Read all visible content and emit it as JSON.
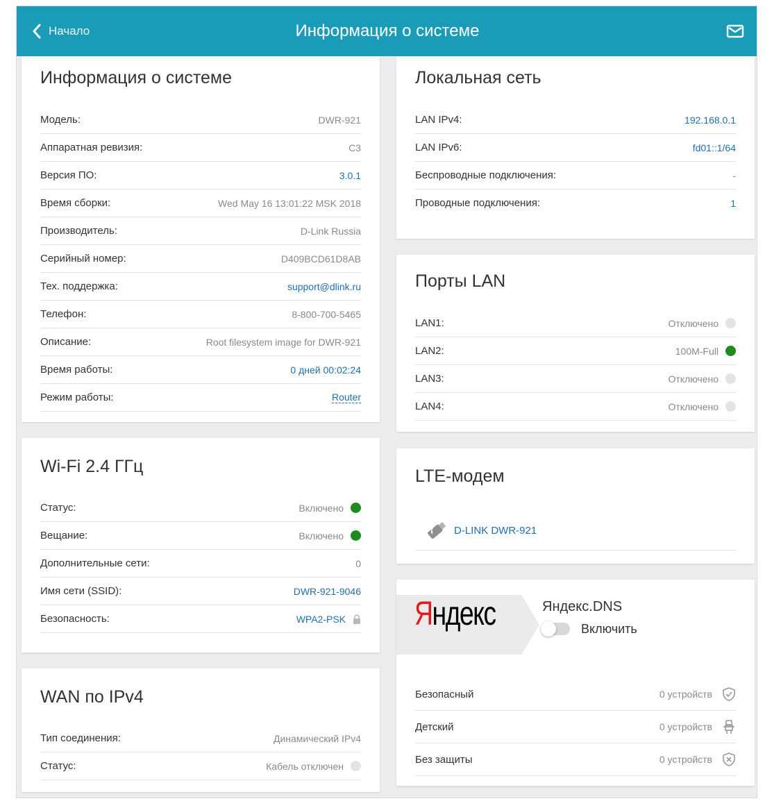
{
  "header": {
    "back_label": "Начало",
    "title": "Информация о системе"
  },
  "system": {
    "title": "Информация о системе",
    "rows": [
      {
        "label": "Модель:",
        "value": "DWR-921"
      },
      {
        "label": "Аппаратная ревизия:",
        "value": "C3"
      },
      {
        "label": "Версия ПО:",
        "value": "3.0.1"
      },
      {
        "label": "Время сборки:",
        "value": "Wed May 16 13:01:22 MSK 2018"
      },
      {
        "label": "Производитель:",
        "value": "D-Link Russia"
      },
      {
        "label": "Серийный номер:",
        "value": "D409BCD61D8AB"
      },
      {
        "label": "Тех. поддержка:",
        "value": "support@dlink.ru"
      },
      {
        "label": "Телефон:",
        "value": "8-800-700-5465"
      },
      {
        "label": "Описание:",
        "value": "Root filesystem image for DWR-921"
      },
      {
        "label": "Время работы:",
        "value": "0 дней 00:02:24"
      },
      {
        "label": "Режим работы:",
        "value": "Router"
      }
    ]
  },
  "wifi": {
    "title": "Wi-Fi 2.4 ГГц",
    "rows": [
      {
        "label": "Статус:",
        "value": "Включено"
      },
      {
        "label": "Вещание:",
        "value": "Включено"
      },
      {
        "label": "Дополнительные сети:",
        "value": "0"
      },
      {
        "label": "Имя сети (SSID):",
        "value": "DWR-921-9046"
      },
      {
        "label": "Безопасность:",
        "value": "WPA2-PSK"
      }
    ]
  },
  "wan": {
    "title": "WAN по IPv4",
    "rows": [
      {
        "label": "Тип соединения:",
        "value": "Динамический IPv4"
      },
      {
        "label": "Статус:",
        "value": "Кабель отключен"
      }
    ]
  },
  "lan": {
    "title": "Локальная сеть",
    "rows": [
      {
        "label": "LAN IPv4:",
        "value": "192.168.0.1"
      },
      {
        "label": "LAN IPv6:",
        "value": "fd01::1/64"
      },
      {
        "label": "Беспроводные подключения:",
        "value": "-"
      },
      {
        "label": "Проводные подключения:",
        "value": "1"
      }
    ]
  },
  "ports": {
    "title": "Порты LAN",
    "rows": [
      {
        "label": "LAN1:",
        "value": "Отключено",
        "status": "off"
      },
      {
        "label": "LAN2:",
        "value": "100M-Full",
        "status": "on"
      },
      {
        "label": "LAN3:",
        "value": "Отключено",
        "status": "off"
      },
      {
        "label": "LAN4:",
        "value": "Отключено",
        "status": "off"
      }
    ]
  },
  "lte": {
    "title": "LTE-модем",
    "device": "D-LINK DWR-921"
  },
  "yandex": {
    "logo": "Яндекс",
    "dns_title": "Яндекс.DNS",
    "toggle_label": "Включить",
    "toggle_on": false,
    "rows": [
      {
        "label": "Безопасный",
        "count": "0 устройств",
        "icon": "shield-check-icon"
      },
      {
        "label": "Детский",
        "count": "0 устройств",
        "icon": "child-icon"
      },
      {
        "label": "Без защиты",
        "count": "0 устройств",
        "icon": "shield-x-icon"
      }
    ]
  },
  "colors": {
    "header": "#1a9bb8",
    "link": "#1f6fb2",
    "status_on": "#1f8a1f",
    "status_off": "#e3e3e3"
  }
}
